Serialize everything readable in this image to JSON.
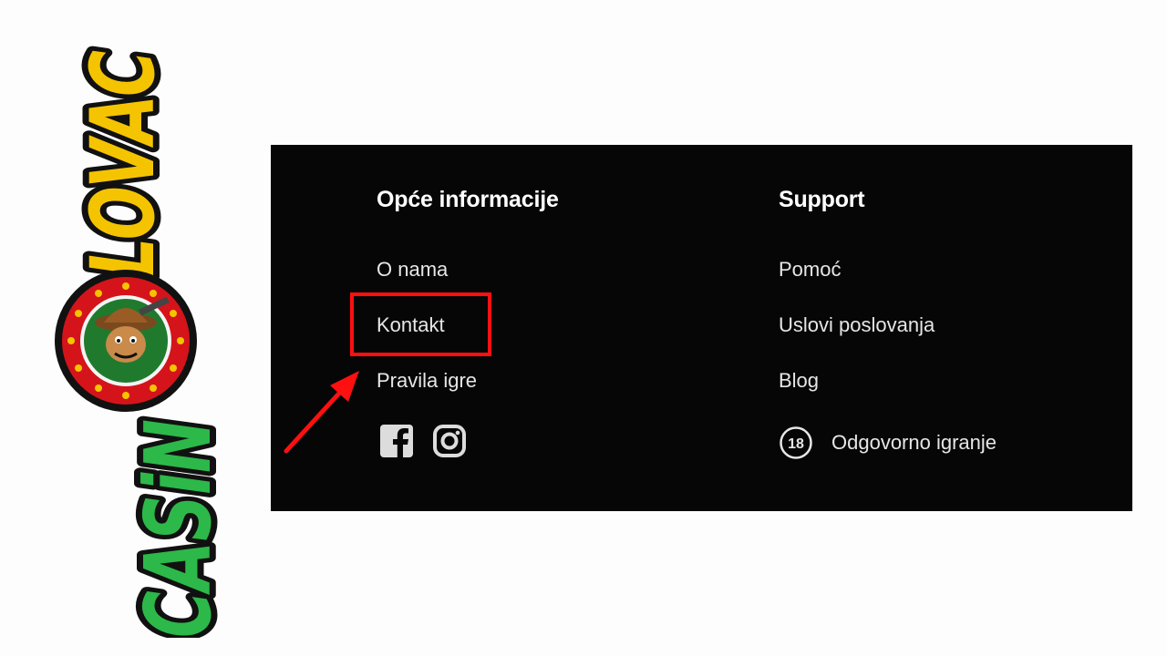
{
  "logo": {
    "brand": "CASINOLOVAC",
    "word_top": "LOVAC",
    "word_bottom": "CASiN",
    "colors": {
      "gold": "#f5c400",
      "green": "#2db84a",
      "badge_red": "#d4141a",
      "badge_green": "#1f7a2e",
      "outline": "#111111"
    }
  },
  "footer": {
    "background": "#060606",
    "general": {
      "title": "Opće informacije",
      "links": [
        "O nama",
        "Kontakt",
        "Pravila igre"
      ],
      "socials": [
        "facebook-icon",
        "instagram-icon"
      ]
    },
    "support": {
      "title": "Support",
      "links": [
        "Pomoć",
        "Uslovi poslovanja",
        "Blog"
      ],
      "responsible": {
        "badge": "18",
        "label": "Odgovorno igranje"
      }
    }
  },
  "annotation": {
    "highlighted_item": "Kontakt",
    "color": "#ff1010"
  }
}
